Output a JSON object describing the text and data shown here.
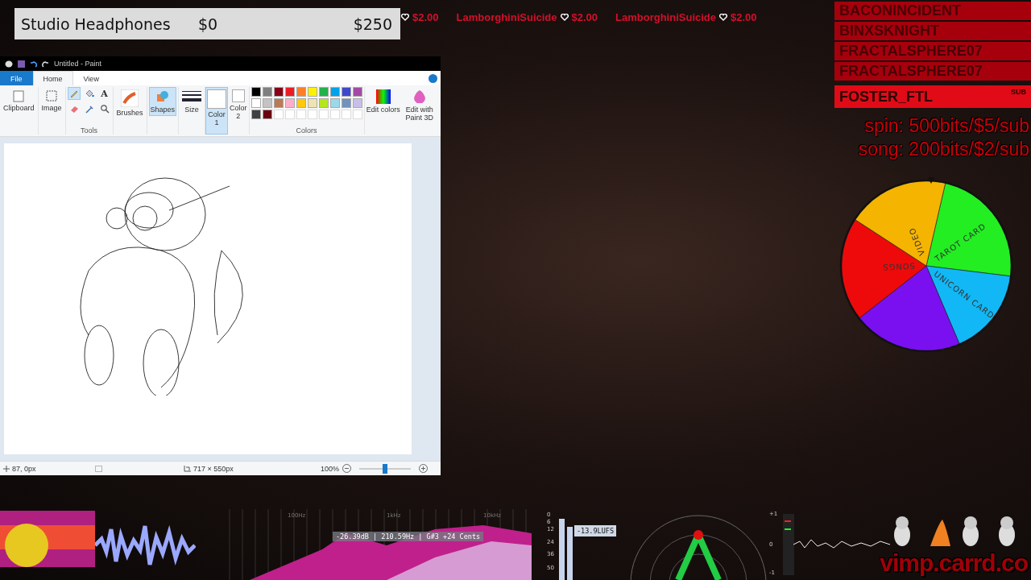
{
  "goal": {
    "name": "Studio Headphones",
    "start": "$0",
    "target": "$250"
  },
  "ticker": [
    {
      "amount": "$2.00"
    },
    {
      "name": "LamborghiniSuicide",
      "amount": "$2.00"
    },
    {
      "name": "LamborghiniSuicide",
      "amount": "$2.00"
    }
  ],
  "events": [
    {
      "name": "BACONINCIDENT",
      "selected": false
    },
    {
      "name": "BINXSKNIGHT",
      "selected": false
    },
    {
      "name": "FRACTALSPHERE07",
      "selected": false
    },
    {
      "name": "FRACTALSPHERE07",
      "selected": false
    },
    {
      "name": "FOSTER_FTL",
      "detail": "SUB",
      "selected": true
    }
  ],
  "prices": [
    "spin: 500bits/$5/sub",
    "song: 200bits/$2/sub"
  ],
  "wheel": [
    {
      "label": "TAROT CARD",
      "color": "#22ee22"
    },
    {
      "label": "UNICORN CARD",
      "color": "#11b8f5"
    },
    {
      "color": "#7a10f0"
    },
    {
      "label": "SONGS",
      "color": "#ee0a0a"
    },
    {
      "label": "VIDEO",
      "color": "#f5b400"
    }
  ],
  "paint": {
    "title": "Untitled - Paint",
    "tabs": [
      {
        "label": "File",
        "kind": "file",
        "selected": false
      },
      {
        "label": "Home",
        "kind": "tab",
        "selected": true
      },
      {
        "label": "View",
        "kind": "tab",
        "selected": false
      }
    ],
    "clipboard": "Clipboard",
    "image": "Image",
    "tools_label": "Tools",
    "tools": [
      {
        "kind": "pencil",
        "selected": true
      },
      {
        "kind": "fill",
        "selected": false
      },
      {
        "kind": "text",
        "label": "A",
        "selected": false
      },
      {
        "kind": "eraser",
        "selected": false
      },
      {
        "kind": "picker",
        "selected": false
      },
      {
        "kind": "magnifier",
        "selected": false
      }
    ],
    "brushes": "Brushes",
    "shapes": "Shapes",
    "size": "Size",
    "color1": {
      "label": "Color",
      "sub": "1",
      "selected": true
    },
    "color2": {
      "label": "Color",
      "sub": "2",
      "selected": false
    },
    "swatches": [
      {
        "kind": "color",
        "color": "#000000"
      },
      {
        "kind": "color",
        "color": "#7f7f7f"
      },
      {
        "kind": "color",
        "color": "#880015"
      },
      {
        "kind": "color",
        "color": "#ed1c24"
      },
      {
        "kind": "color",
        "color": "#ff7f27"
      },
      {
        "kind": "color",
        "color": "#fff200"
      },
      {
        "kind": "color",
        "color": "#22b14c"
      },
      {
        "kind": "color",
        "color": "#00a2e8"
      },
      {
        "kind": "color",
        "color": "#3f48cc"
      },
      {
        "kind": "color",
        "color": "#a349a4"
      },
      {
        "kind": "color",
        "color": "#ffffff"
      },
      {
        "kind": "color",
        "color": "#c3c3c3"
      },
      {
        "kind": "color",
        "color": "#b97a57"
      },
      {
        "kind": "color",
        "color": "#ffaec9"
      },
      {
        "kind": "color",
        "color": "#ffc90e"
      },
      {
        "kind": "color",
        "color": "#efe4b0"
      },
      {
        "kind": "color",
        "color": "#b5e61d"
      },
      {
        "kind": "color",
        "color": "#99d9ea"
      },
      {
        "kind": "color",
        "color": "#7092be"
      },
      {
        "kind": "color",
        "color": "#c8bfe7"
      },
      {
        "kind": "color",
        "color": "#404040"
      },
      {
        "kind": "color",
        "color": "#6a0010"
      },
      {
        "kind": "empty"
      },
      {
        "kind": "empty"
      },
      {
        "kind": "empty"
      },
      {
        "kind": "empty"
      },
      {
        "kind": "empty"
      },
      {
        "kind": "empty"
      },
      {
        "kind": "empty"
      },
      {
        "kind": "empty"
      }
    ],
    "colors_label": "Colors",
    "edit_colors": "Edit colors",
    "paint3d": "Edit with Paint 3D",
    "status": {
      "position": "87, 0px",
      "canvas_size": "717 × 550px",
      "zoom": "100%",
      "level": 0.5
    }
  },
  "visualizer": {
    "readout": "-26.39dB | 210.59Hz | G#3 +24 Cents",
    "freq_labels": [
      "100Hz",
      "1kHz",
      "10kHz"
    ],
    "loudness_scale": [
      "0",
      "6",
      "12",
      "24",
      "36",
      "50"
    ],
    "lufs": "-13.9LUFS",
    "meter_scale": [
      "+1",
      "0",
      "-1"
    ]
  },
  "site": "vimp.carrd.co"
}
